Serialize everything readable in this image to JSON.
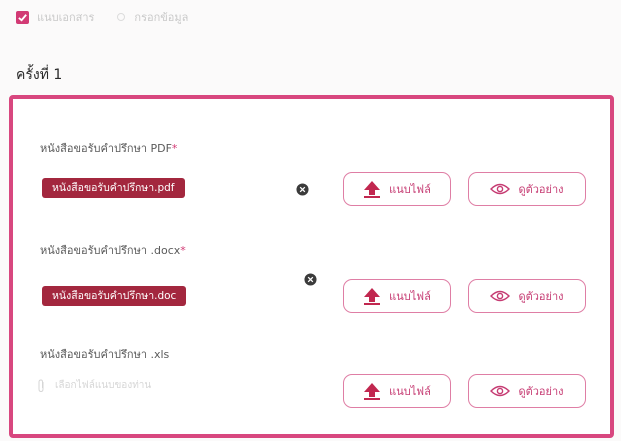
{
  "steps": [
    {
      "label": "แนบเอกสาร",
      "state": "done"
    },
    {
      "label": "กรอกข้อมูล",
      "state": "pending"
    }
  ],
  "round_title": "ครั้งที่ 1",
  "documents": [
    {
      "label": "หนังสือขอรับคำปรึกษา PDF",
      "required": "*",
      "file_name": "หนังสือขอรับคำปรึกษา.pdf",
      "upload_label": "แนบไฟล์",
      "preview_label": "ดูตัวอย่าง"
    },
    {
      "label": "หนังสือขอรับคำปรึกษา .docx",
      "required": "*",
      "file_name": "หนังสือขอรับคำปรึกษา.doc",
      "upload_label": "แนบไฟล์",
      "preview_label": "ดูตัวอย่าง"
    },
    {
      "label": "หนังสือขอรับคำปรึกษา .xls",
      "required": "",
      "placeholder": "เลือกไฟล์แนบของท่าน",
      "upload_label": "แนบไฟล์",
      "preview_label": "ดูตัวอย่าง"
    }
  ],
  "colors": {
    "accent": "#d8477f",
    "chip": "#a3273e",
    "upload_arrow": "#c1274f"
  },
  "icons": [
    "check-icon",
    "step-pending-icon",
    "remove-file-icon",
    "upload-arrow-icon",
    "eye-icon",
    "attachment-icon"
  ]
}
